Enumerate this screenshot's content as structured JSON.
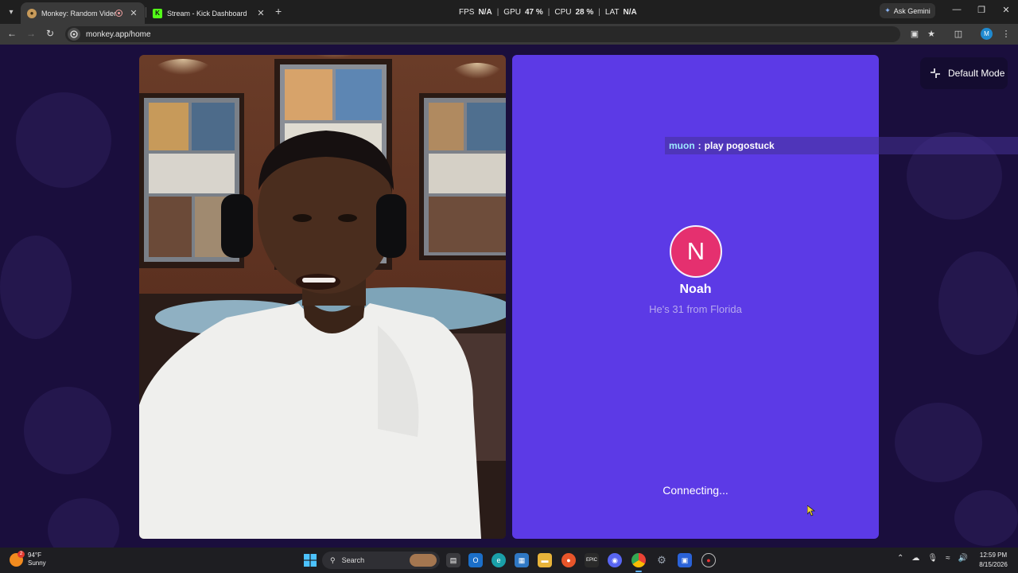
{
  "browser": {
    "tabs": [
      {
        "title": "Monkey: Random Video Ch",
        "active": true
      },
      {
        "title": "Stream - Kick Dashboard",
        "active": false
      }
    ],
    "perf": [
      {
        "label": "FPS",
        "value": "N/A"
      },
      {
        "label": "GPU",
        "value": "47 %"
      },
      {
        "label": "CPU",
        "value": "28 %"
      },
      {
        "label": "LAT",
        "value": "N/A"
      }
    ],
    "gemini_label": "Ask Gemini",
    "url": "monkey.app/home",
    "profile_initial": "M"
  },
  "page": {
    "mode_button_label": "Default Mode",
    "chat": {
      "user": "muon",
      "separator": ":",
      "message": "play pogostuck"
    },
    "partner": {
      "initial": "N",
      "name": "Noah",
      "info": "He's 31 from Florida"
    },
    "status": "Connecting...",
    "colors": {
      "background": "#1a0e3d",
      "panel": "#5c3ae6",
      "avatar": "#e5306f",
      "chat_user": "#9ee8ff"
    }
  },
  "taskbar": {
    "weather": {
      "temp": "94°F",
      "condition": "Sunny",
      "badge": "2"
    },
    "search_placeholder": "Search",
    "time": "12:59 PM",
    "date": "8/15/2026"
  }
}
